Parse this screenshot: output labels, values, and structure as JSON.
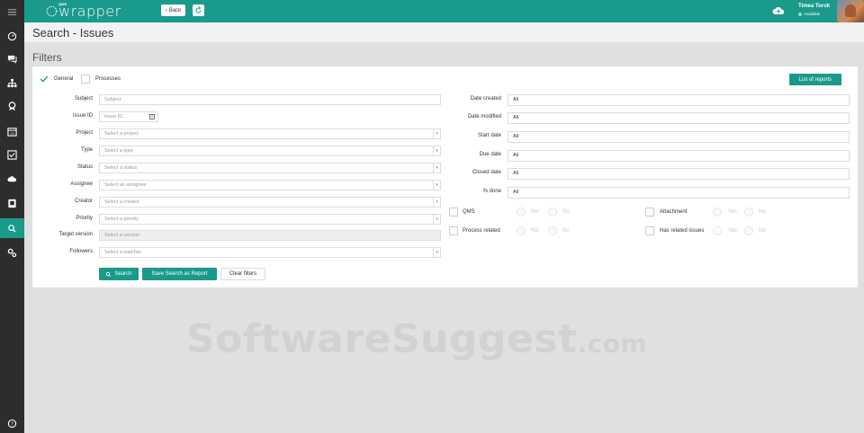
{
  "app": {
    "logo_text": "wrapper",
    "logo_tag": "QMS",
    "back_label": "Back"
  },
  "user": {
    "name": "Timea Torok",
    "status": "Available"
  },
  "page": {
    "title": "Search - Issues",
    "section_title": "Filters"
  },
  "tabs": [
    {
      "label": "General",
      "checked": true
    },
    {
      "label": "Processes",
      "checked": false
    }
  ],
  "list_reports_label": "List of reports",
  "left_fields": [
    {
      "label": "Subject",
      "placeholder": "Subject",
      "kind": "text"
    },
    {
      "label": "Issue ID",
      "placeholder": "Issue ID",
      "kind": "number"
    },
    {
      "label": "Project",
      "placeholder": "Select a project",
      "kind": "select"
    },
    {
      "label": "Type",
      "placeholder": "Select a type",
      "kind": "select"
    },
    {
      "label": "Status",
      "placeholder": "Select a status",
      "kind": "select"
    },
    {
      "label": "Assignee",
      "placeholder": "Select an assignee",
      "kind": "select"
    },
    {
      "label": "Creator",
      "placeholder": "Select a creator",
      "kind": "select"
    },
    {
      "label": "Priority",
      "placeholder": "Select a priority",
      "kind": "select"
    },
    {
      "label": "Target version",
      "placeholder": "Select a version",
      "kind": "disabled"
    },
    {
      "label": "Followers",
      "placeholder": "Select a watcher",
      "kind": "select"
    }
  ],
  "right_fields": [
    {
      "label": "Date created",
      "value": "All"
    },
    {
      "label": "Date modified",
      "value": "All"
    },
    {
      "label": "Start date",
      "value": "All"
    },
    {
      "label": "Due date",
      "value": "All"
    },
    {
      "label": "Closed date",
      "value": "All"
    },
    {
      "label": "% done",
      "value": "All"
    }
  ],
  "toggles": [
    {
      "label": "QMS",
      "yes": "Yes",
      "no": "No"
    },
    {
      "label": "Attachment",
      "yes": "Yes",
      "no": "No"
    },
    {
      "label": "Process related",
      "yes": "Yes",
      "no": "No"
    },
    {
      "label": "Has related issues",
      "yes": "Yes",
      "no": "No"
    }
  ],
  "actions": {
    "search": "Search",
    "save": "Save Search as Report",
    "clear": "Clear filters"
  },
  "watermark": {
    "main": "SoftwareSuggest",
    "suffix": ".com"
  },
  "sidebar_icons": [
    "menu-icon",
    "dashboard-icon",
    "chat-icon",
    "org-chart-icon",
    "award-icon",
    "calendar-icon",
    "checklist-icon",
    "cloud-icon",
    "document-icon",
    "search-icon",
    "settings-icon",
    "help-icon"
  ],
  "colors": {
    "accent": "#1a9a8a",
    "sidebar": "#2d2d2d",
    "background": "#e0e0e0"
  }
}
